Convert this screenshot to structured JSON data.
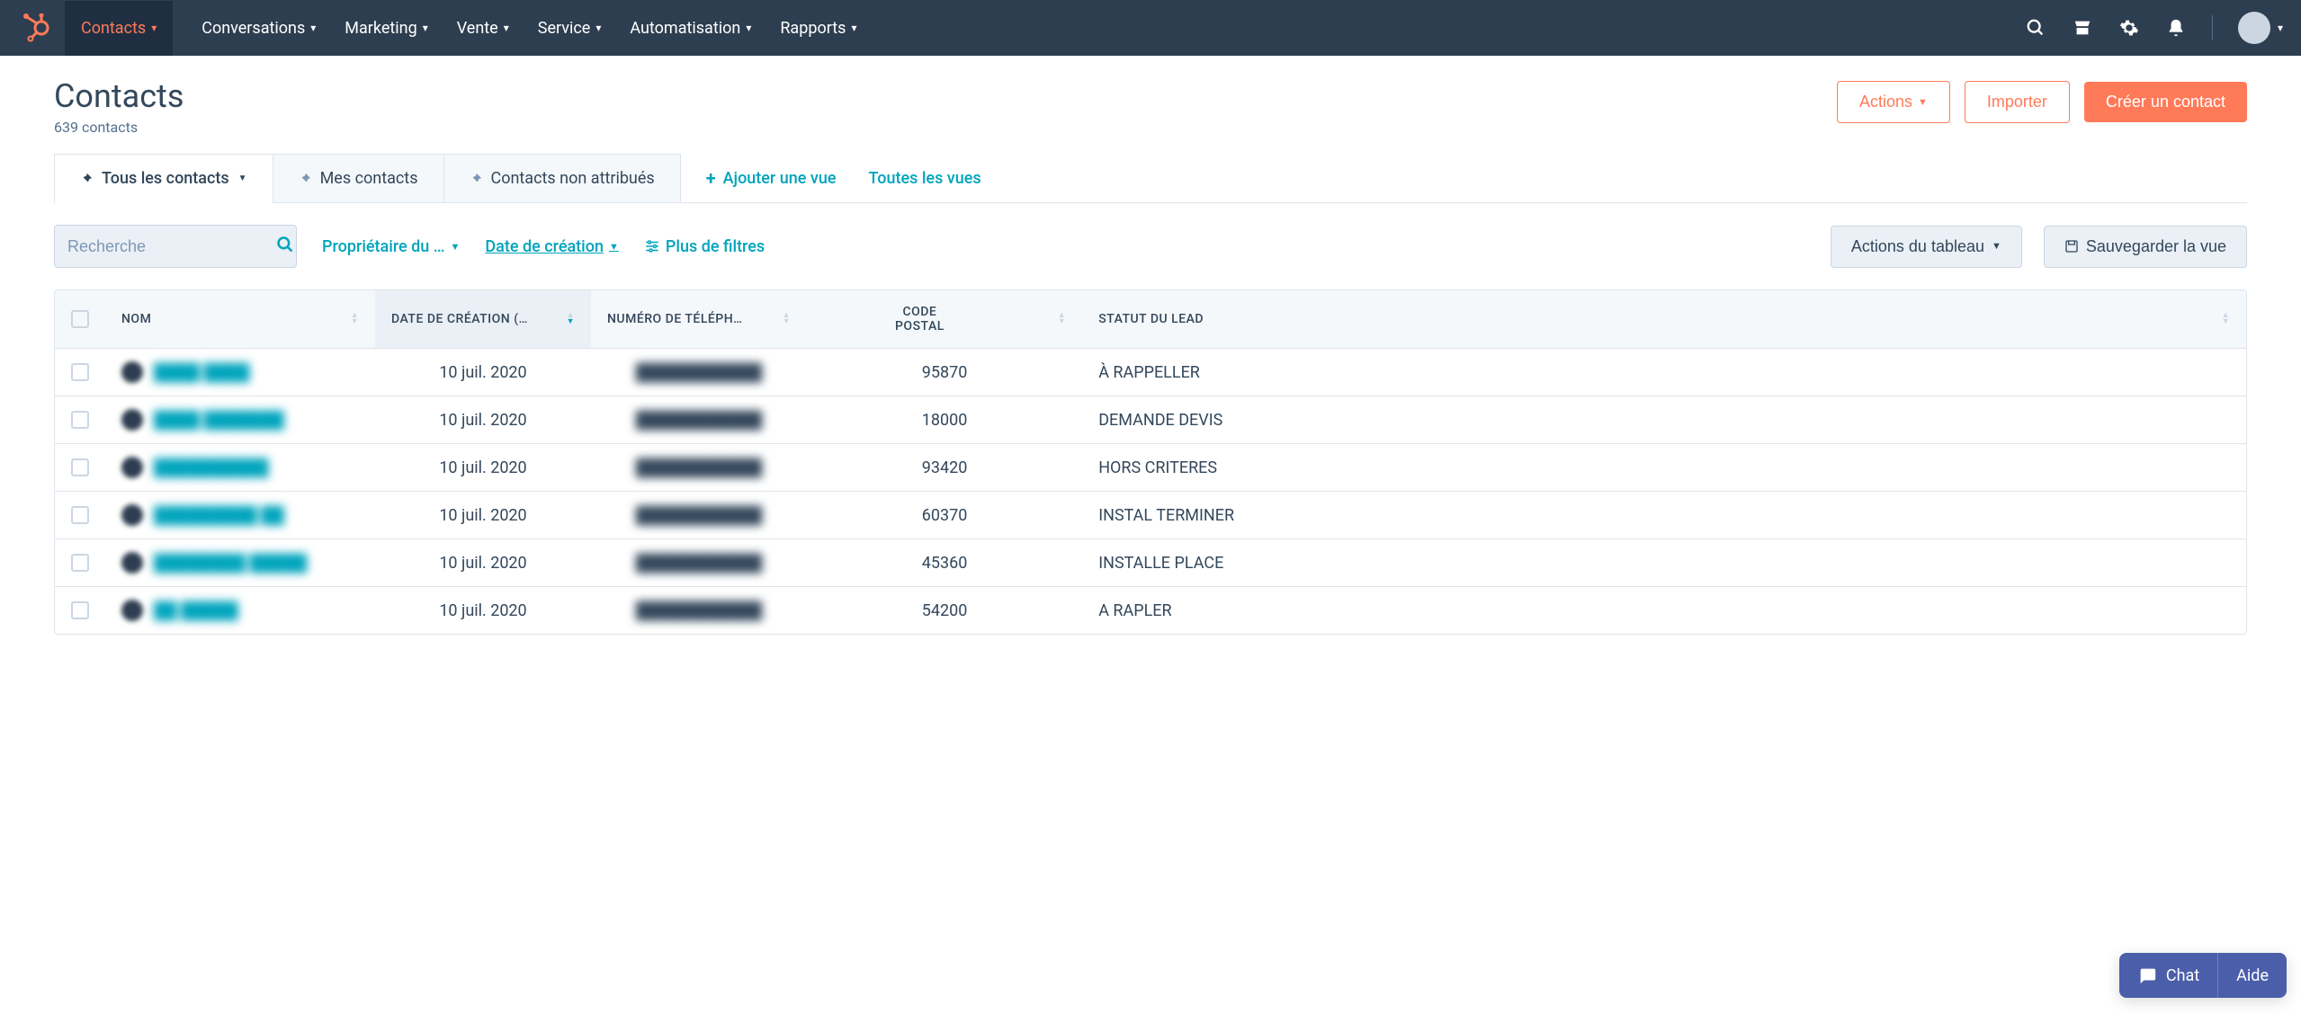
{
  "nav": {
    "items": [
      "Contacts",
      "Conversations",
      "Marketing",
      "Vente",
      "Service",
      "Automatisation",
      "Rapports"
    ],
    "active_index": 0
  },
  "page_title": "Contacts",
  "subtitle": "639 contacts",
  "actions": {
    "actions_label": "Actions",
    "import_label": "Importer",
    "create_label": "Créer un contact"
  },
  "tabs": [
    {
      "label": "Tous les contacts",
      "active": true,
      "has_caret": true
    },
    {
      "label": "Mes contacts",
      "active": false
    },
    {
      "label": "Contacts non attribués",
      "active": false
    }
  ],
  "tab_links": {
    "add_view": "Ajouter une vue",
    "all_views": "Toutes les vues"
  },
  "filters": {
    "search_placeholder": "Recherche",
    "owner": "Propriétaire du …",
    "create_date": "Date de création",
    "more_filters": "Plus de filtres",
    "table_actions": "Actions du tableau",
    "save_view": "Sauvegarder la vue"
  },
  "table": {
    "headers": {
      "name": "NOM",
      "created": "DATE DE CRÉATION (…",
      "phone": "NUMÉRO DE TÉLÉPH…",
      "postal": "CODE POSTAL",
      "status": "STATUT DU LEAD"
    },
    "rows": [
      {
        "name": "████ ████",
        "date": "10 juil. 2020",
        "phone": "███████████",
        "postal": "95870",
        "status": "À RAPPELLER"
      },
      {
        "name": "████ ███████",
        "date": "10 juil. 2020",
        "phone": "███████████",
        "postal": "18000",
        "status": "DEMANDE DEVIS"
      },
      {
        "name": "██████████",
        "date": "10 juil. 2020",
        "phone": "███████████",
        "postal": "93420",
        "status": "HORS CRITERES"
      },
      {
        "name": "█████████ ██",
        "date": "10 juil. 2020",
        "phone": "███████████",
        "postal": "60370",
        "status": "INSTAL TERMINER"
      },
      {
        "name": "████████ █████",
        "date": "10 juil. 2020",
        "phone": "███████████",
        "postal": "45360",
        "status": "INSTALLE PLACE"
      },
      {
        "name": "██ █████",
        "date": "10 juil. 2020",
        "phone": "███████████",
        "postal": "54200",
        "status": "A RAPLER"
      }
    ]
  },
  "chat": {
    "chat_label": "Chat",
    "help_label": "Aide"
  }
}
